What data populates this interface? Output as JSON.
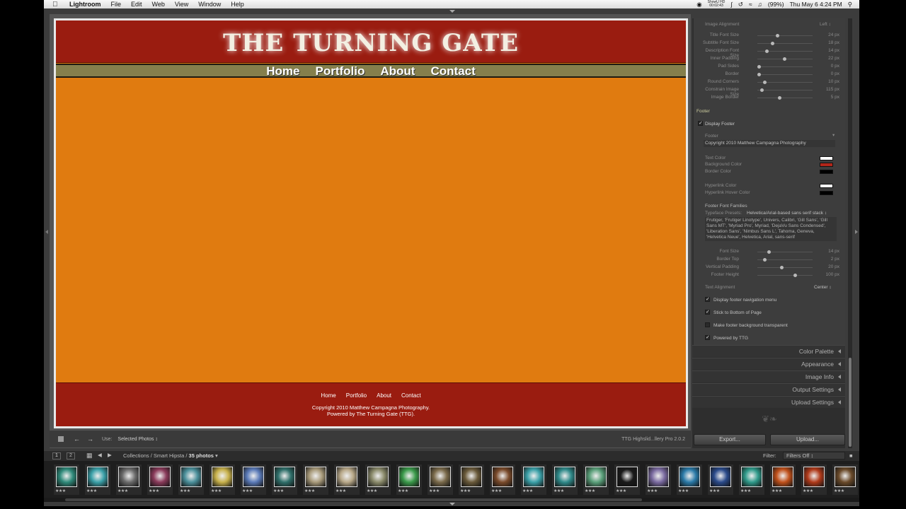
{
  "menubar": {
    "app": "Lightroom",
    "menus": [
      "File",
      "Edit",
      "Web",
      "View",
      "Window",
      "Help"
    ],
    "battery": "(99%)",
    "datetime": "Thu May 6  4:24 PM",
    "recorder_line1": "ShowU HD",
    "recorder_line2": "00:02:43"
  },
  "site": {
    "title": "THE TURNING GATE",
    "nav": [
      "Home",
      "Portfolio",
      "About",
      "Contact"
    ],
    "footer_nav": [
      "Home",
      "Portfolio",
      "About",
      "Contact"
    ],
    "copyright": "Copyright 2010 Matthew Campagna Photography.",
    "powered": "Powered by The Turning Gate (TTG)."
  },
  "toolbar": {
    "use_label": "Use:",
    "use_value": "Selected Photos",
    "engine": "TTG Highslid...llery Pro 2.0.2"
  },
  "panel": {
    "image_alignment_label": "Image Alignment",
    "image_alignment_value": "Left",
    "sliders_top": [
      {
        "label": "Title Font Size",
        "value": "24 px",
        "pos": 0.35
      },
      {
        "label": "Subtitle Font Size",
        "value": "18 px",
        "pos": 0.25
      },
      {
        "label": "Description Font Size",
        "value": "14 px",
        "pos": 0.15
      },
      {
        "label": "Inner Padding",
        "value": "22 px",
        "pos": 0.48
      },
      {
        "label": "Pad Sides",
        "value": "0 px",
        "pos": 0.0
      },
      {
        "label": "Border",
        "value": "0 px",
        "pos": 0.0
      },
      {
        "label": "Round Corners",
        "value": "10 px",
        "pos": 0.1
      },
      {
        "label": "Constrain Image Size",
        "value": "115 px",
        "pos": 0.05
      },
      {
        "label": "Image Border",
        "value": "5 px",
        "pos": 0.38
      }
    ],
    "footer_section": "Footer",
    "display_footer": "Display Footer",
    "footer_field_label": "Footer",
    "footer_field_value": "Copyright 2010 Matthew Campagna Photography",
    "colors": [
      {
        "label": "Text Color",
        "color": "#ffffff"
      },
      {
        "label": "Background Color",
        "color": "#b3261a"
      },
      {
        "label": "Border Color",
        "color": "#000000"
      },
      {
        "label": "Hyperlink Color",
        "color": "#ffffff"
      },
      {
        "label": "Hyperlink Hover Color",
        "color": "#000000"
      }
    ],
    "font_families_label": "Footer Font Families",
    "typeface_label": "Typeface Presets:",
    "typeface_value": "Helvetica/Arial-based sans serif stack",
    "font_stack": "Frutiger, 'Frutiger Linotype', Univers, Calibri, 'Gill Sans', 'Gill Sans MT', 'Myriad Pro', Myriad, 'DejaVu Sans Condensed', 'Liberation Sans', 'Nimbus Sans L', Tahoma, Geneva, 'Helvetica Neue', Helvetica, Arial, sans-serif",
    "sliders_bottom": [
      {
        "label": "Font Size",
        "value": "14 px",
        "pos": 0.18
      },
      {
        "label": "Border Top",
        "value": "2 px",
        "pos": 0.1
      },
      {
        "label": "Vertical Padding",
        "value": "20 px",
        "pos": 0.42
      },
      {
        "label": "Footer Height",
        "value": "100 px",
        "pos": 0.68
      }
    ],
    "text_alignment_label": "Text Alignment",
    "text_alignment_value": "Center",
    "checkboxes": [
      {
        "label": "Display footer navigation menu",
        "checked": true
      },
      {
        "label": "Stick to Bottom of Page",
        "checked": true
      },
      {
        "label": "Make footer background transparent",
        "checked": false
      },
      {
        "label": "Powered by TTG",
        "checked": true
      }
    ],
    "collapsed_sections": [
      "Color Palette",
      "Appearance",
      "Image Info",
      "Output Settings",
      "Upload Settings"
    ],
    "export_button": "Export...",
    "upload_button": "Upload..."
  },
  "filmstrip": {
    "pages": [
      "1",
      "2"
    ],
    "path": "Collections / Smart Hipsta /",
    "count": "35 photos",
    "filter_label": "Filter:",
    "filter_value": "Filters Off",
    "stars": "★★★",
    "thumbs": [
      "#2f8a7a",
      "#3aa0a8",
      "#6b6b6b",
      "#8a3a5a",
      "#4a8f9a",
      "#c7b04a",
      "#5a7ab8",
      "#2f6f6a",
      "#a89a7a",
      "#b8a888",
      "#8a8a6a",
      "#3a9a4a",
      "#7a6a4a",
      "#6a5a3a",
      "#7a4a2a",
      "#3aa0a8",
      "#2f8a8a",
      "#5aa07a",
      "#1a1a1a",
      "#7a6aa0",
      "#2a7aa8",
      "#2a4a8a",
      "#2f9a8a",
      "#c0501a",
      "#b03a1a",
      "#6a4a2a"
    ]
  }
}
